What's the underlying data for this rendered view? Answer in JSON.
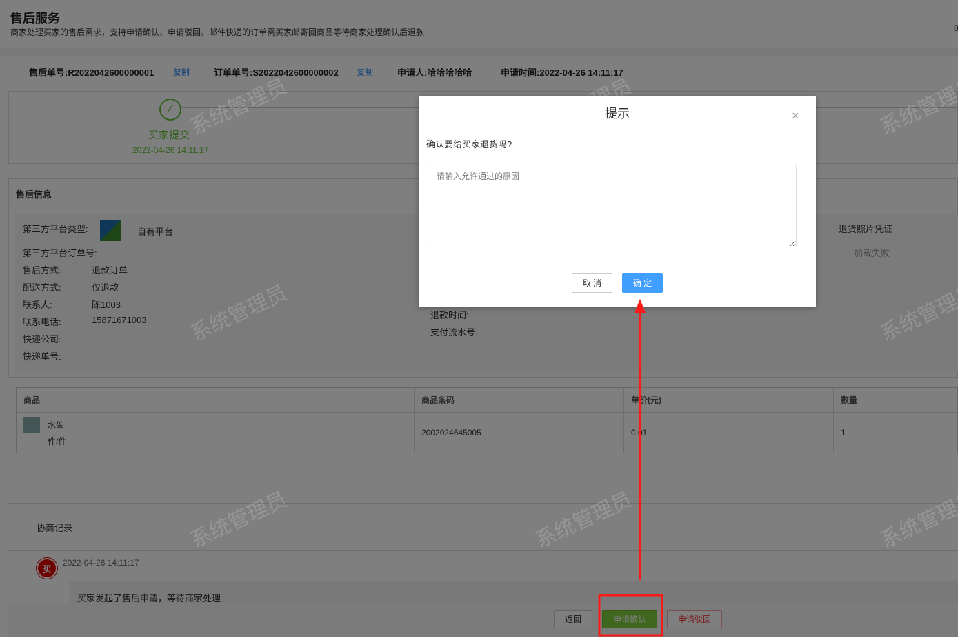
{
  "header": {
    "title": "售后服务",
    "subtitle": "商家处理买家的售后需求，支持申请确认、申请驳回。邮件快递的订单需买家邮寄回商品等待商家处理确认后退款",
    "corner": "0"
  },
  "meta": {
    "aftersale_no": "售后单号:R2022042600000001",
    "order_no": "订单单号:S2022042600000002",
    "applicant": "申请人:哈哈哈哈哈",
    "apply_time": "申请时间:2022-04-26 14:11:17",
    "copy": "复制"
  },
  "step": {
    "label": "买家提交",
    "time": "2022-04-26 14:11:17"
  },
  "info": {
    "title": "售后信息",
    "platform_type_label": "第三方平台类型:",
    "platform_type": "自有平台",
    "platform_order_label": "第三方平台订单号:",
    "method_label": "售后方式:",
    "method": "退款订单",
    "delivery_label": "配送方式:",
    "delivery": "仅退款",
    "contact_label": "联系人:",
    "contact": "陈1003",
    "phone_label": "联系电话:",
    "phone": "15871671003",
    "express_label": "快递公司:",
    "express_no_label": "快递单号:",
    "refund_time_label": "退款时间:",
    "pay_serial_label": "支付流水号:",
    "photo_label": "退货照片凭证",
    "photo_status": "加载失败"
  },
  "table": {
    "headers": [
      "商品",
      "商品条码",
      "单价(元)",
      "数量"
    ],
    "rows": [
      {
        "name": "水架",
        "unit": "件/件",
        "barcode": "2002024645005",
        "price": "0.01",
        "qty": "1"
      }
    ]
  },
  "negotiation": {
    "title": "协商记录",
    "badge": "买",
    "time": "2022-04-26 14:11:17",
    "message": "买家发起了售后申请，等待商家处理"
  },
  "actions": {
    "back": "返回",
    "confirm": "申请确认",
    "reject": "申请驳回"
  },
  "watermark": "系统管理员",
  "dialog": {
    "title": "提示",
    "question": "确认要给买家退货吗?",
    "placeholder": "请输入允许通过的原因",
    "cancel": "取 消",
    "ok": "确 定"
  }
}
